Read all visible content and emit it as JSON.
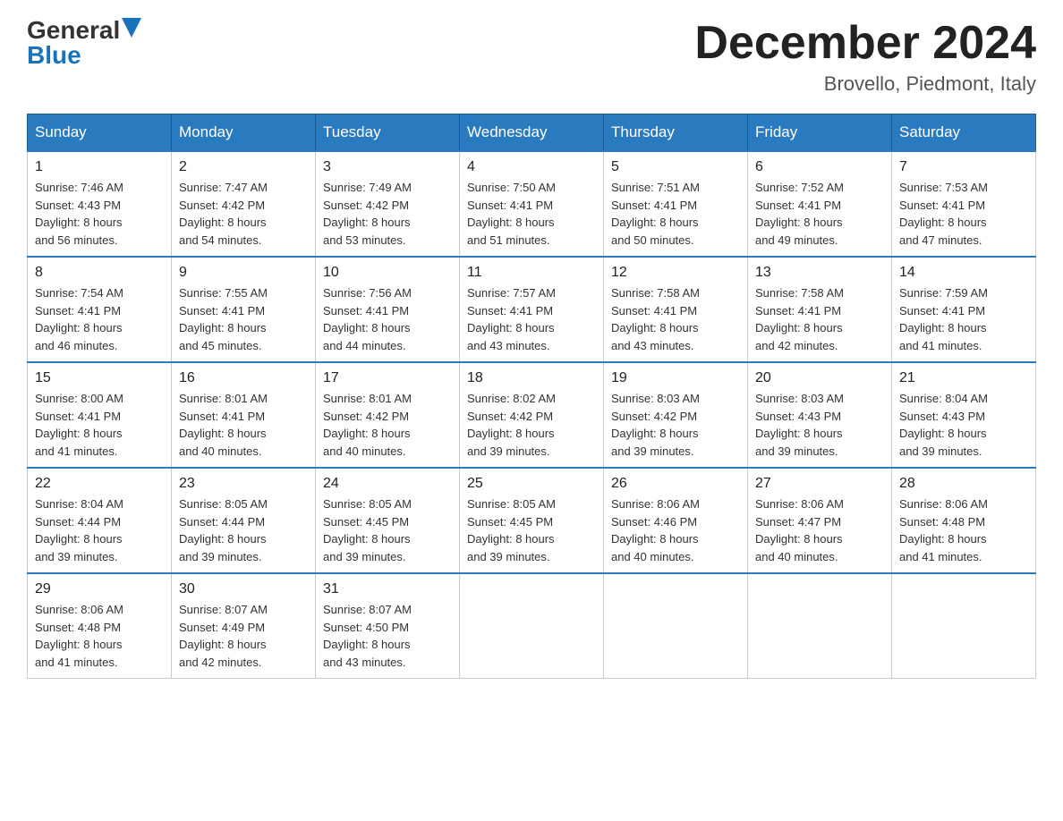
{
  "header": {
    "logo_general": "General",
    "logo_blue": "Blue",
    "month_title": "December 2024",
    "location": "Brovello, Piedmont, Italy"
  },
  "weekdays": [
    "Sunday",
    "Monday",
    "Tuesday",
    "Wednesday",
    "Thursday",
    "Friday",
    "Saturday"
  ],
  "weeks": [
    [
      {
        "day": "1",
        "sunrise": "7:46 AM",
        "sunset": "4:43 PM",
        "daylight": "8 hours and 56 minutes."
      },
      {
        "day": "2",
        "sunrise": "7:47 AM",
        "sunset": "4:42 PM",
        "daylight": "8 hours and 54 minutes."
      },
      {
        "day": "3",
        "sunrise": "7:49 AM",
        "sunset": "4:42 PM",
        "daylight": "8 hours and 53 minutes."
      },
      {
        "day": "4",
        "sunrise": "7:50 AM",
        "sunset": "4:41 PM",
        "daylight": "8 hours and 51 minutes."
      },
      {
        "day": "5",
        "sunrise": "7:51 AM",
        "sunset": "4:41 PM",
        "daylight": "8 hours and 50 minutes."
      },
      {
        "day": "6",
        "sunrise": "7:52 AM",
        "sunset": "4:41 PM",
        "daylight": "8 hours and 49 minutes."
      },
      {
        "day": "7",
        "sunrise": "7:53 AM",
        "sunset": "4:41 PM",
        "daylight": "8 hours and 47 minutes."
      }
    ],
    [
      {
        "day": "8",
        "sunrise": "7:54 AM",
        "sunset": "4:41 PM",
        "daylight": "8 hours and 46 minutes."
      },
      {
        "day": "9",
        "sunrise": "7:55 AM",
        "sunset": "4:41 PM",
        "daylight": "8 hours and 45 minutes."
      },
      {
        "day": "10",
        "sunrise": "7:56 AM",
        "sunset": "4:41 PM",
        "daylight": "8 hours and 44 minutes."
      },
      {
        "day": "11",
        "sunrise": "7:57 AM",
        "sunset": "4:41 PM",
        "daylight": "8 hours and 43 minutes."
      },
      {
        "day": "12",
        "sunrise": "7:58 AM",
        "sunset": "4:41 PM",
        "daylight": "8 hours and 43 minutes."
      },
      {
        "day": "13",
        "sunrise": "7:58 AM",
        "sunset": "4:41 PM",
        "daylight": "8 hours and 42 minutes."
      },
      {
        "day": "14",
        "sunrise": "7:59 AM",
        "sunset": "4:41 PM",
        "daylight": "8 hours and 41 minutes."
      }
    ],
    [
      {
        "day": "15",
        "sunrise": "8:00 AM",
        "sunset": "4:41 PM",
        "daylight": "8 hours and 41 minutes."
      },
      {
        "day": "16",
        "sunrise": "8:01 AM",
        "sunset": "4:41 PM",
        "daylight": "8 hours and 40 minutes."
      },
      {
        "day": "17",
        "sunrise": "8:01 AM",
        "sunset": "4:42 PM",
        "daylight": "8 hours and 40 minutes."
      },
      {
        "day": "18",
        "sunrise": "8:02 AM",
        "sunset": "4:42 PM",
        "daylight": "8 hours and 39 minutes."
      },
      {
        "day": "19",
        "sunrise": "8:03 AM",
        "sunset": "4:42 PM",
        "daylight": "8 hours and 39 minutes."
      },
      {
        "day": "20",
        "sunrise": "8:03 AM",
        "sunset": "4:43 PM",
        "daylight": "8 hours and 39 minutes."
      },
      {
        "day": "21",
        "sunrise": "8:04 AM",
        "sunset": "4:43 PM",
        "daylight": "8 hours and 39 minutes."
      }
    ],
    [
      {
        "day": "22",
        "sunrise": "8:04 AM",
        "sunset": "4:44 PM",
        "daylight": "8 hours and 39 minutes."
      },
      {
        "day": "23",
        "sunrise": "8:05 AM",
        "sunset": "4:44 PM",
        "daylight": "8 hours and 39 minutes."
      },
      {
        "day": "24",
        "sunrise": "8:05 AM",
        "sunset": "4:45 PM",
        "daylight": "8 hours and 39 minutes."
      },
      {
        "day": "25",
        "sunrise": "8:05 AM",
        "sunset": "4:45 PM",
        "daylight": "8 hours and 39 minutes."
      },
      {
        "day": "26",
        "sunrise": "8:06 AM",
        "sunset": "4:46 PM",
        "daylight": "8 hours and 40 minutes."
      },
      {
        "day": "27",
        "sunrise": "8:06 AM",
        "sunset": "4:47 PM",
        "daylight": "8 hours and 40 minutes."
      },
      {
        "day": "28",
        "sunrise": "8:06 AM",
        "sunset": "4:48 PM",
        "daylight": "8 hours and 41 minutes."
      }
    ],
    [
      {
        "day": "29",
        "sunrise": "8:06 AM",
        "sunset": "4:48 PM",
        "daylight": "8 hours and 41 minutes."
      },
      {
        "day": "30",
        "sunrise": "8:07 AM",
        "sunset": "4:49 PM",
        "daylight": "8 hours and 42 minutes."
      },
      {
        "day": "31",
        "sunrise": "8:07 AM",
        "sunset": "4:50 PM",
        "daylight": "8 hours and 43 minutes."
      },
      null,
      null,
      null,
      null
    ]
  ]
}
